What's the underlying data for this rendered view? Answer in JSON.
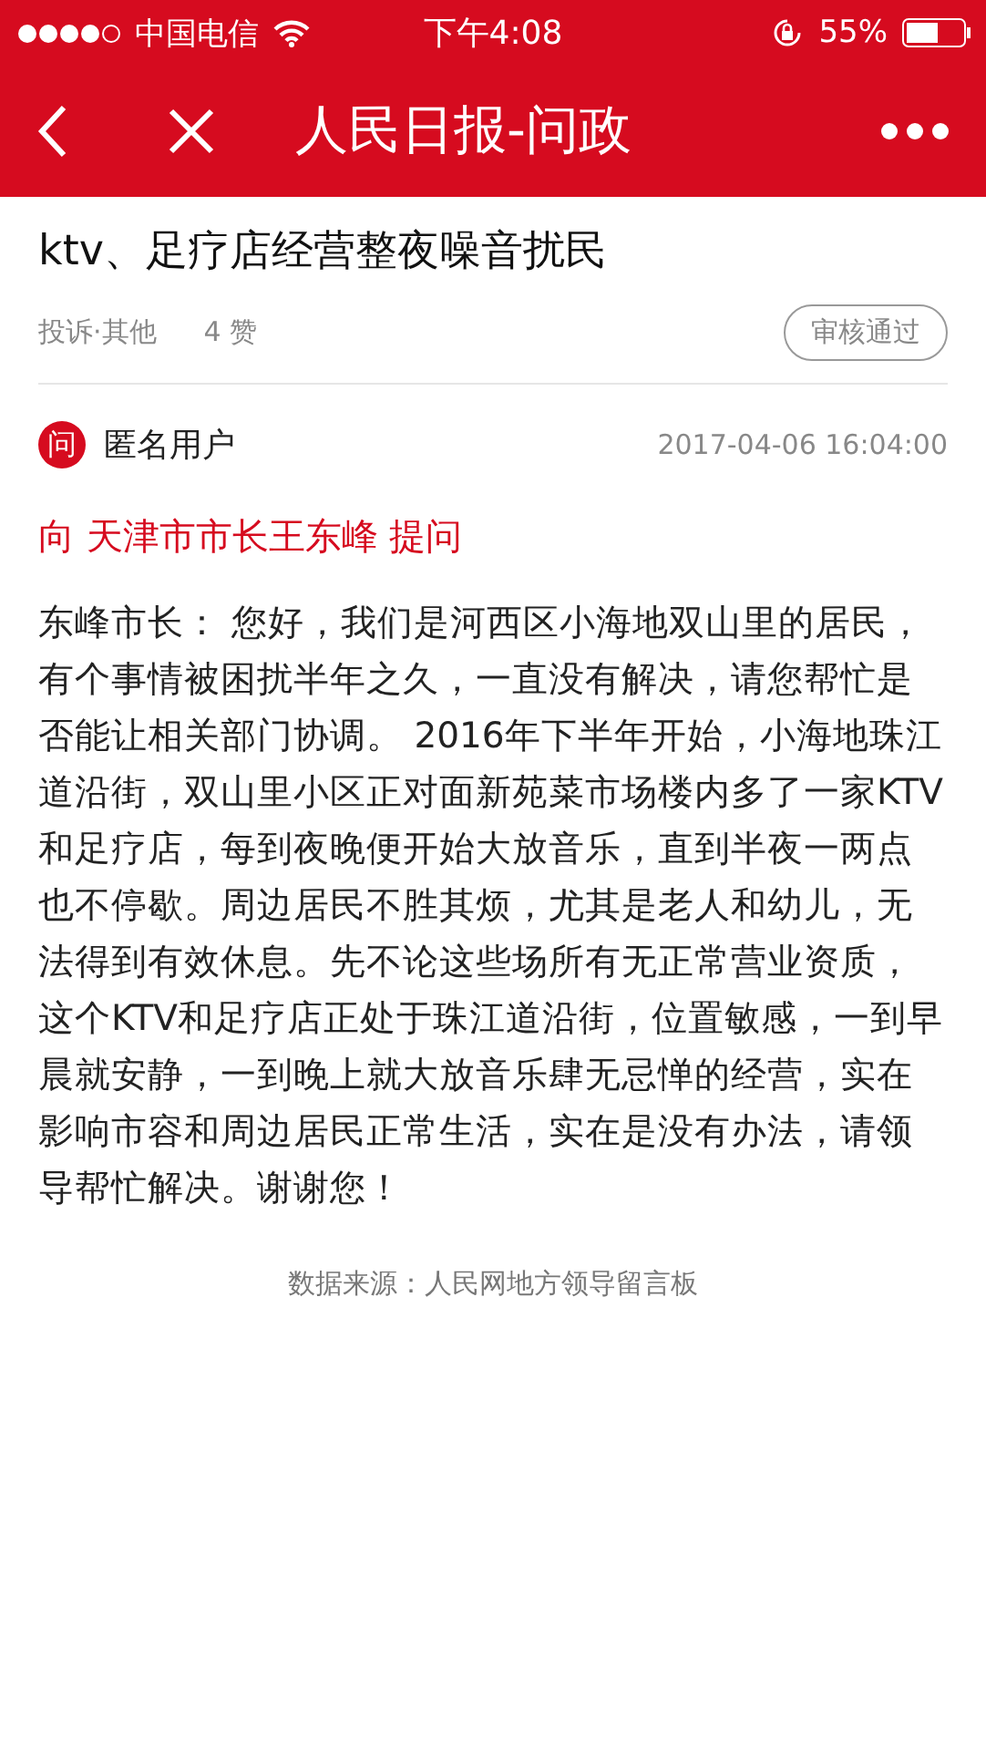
{
  "status_bar": {
    "carrier": "中国电信",
    "time": "下午4:08",
    "battery": "55%"
  },
  "nav": {
    "title": "人民日报-问政"
  },
  "article": {
    "title": "ktv、足疗店经营整夜噪音扰民",
    "category": "投诉·其他",
    "likes": "4 赞",
    "status": "审核通过",
    "author_badge": "问",
    "author": "匿名用户",
    "date": "2017-04-06 16:04:00",
    "recipient": "向 天津市市长王东峰 提问",
    "body": "东峰市长： 您好，我们是河西区小海地双山里的居民，有个事情被困扰半年之久，一直没有解决，请您帮忙是否能让相关部门协调。 2016年下半年开始，小海地珠江道沿街，双山里小区正对面新苑菜市场楼内多了一家KTV和足疗店，每到夜晚便开始大放音乐，直到半夜一两点也不停歇。周边居民不胜其烦，尤其是老人和幼儿，无法得到有效休息。先不论这些场所有无正常营业资质，这个KTV和足疗店正处于珠江道沿街，位置敏感，一到早晨就安静，一到晚上就大放音乐肆无忌惮的经营，实在影响市容和周边居民正常生活，实在是没有办法，请领导帮忙解决。谢谢您！",
    "source": "数据来源：人民网地方领导留言板"
  }
}
